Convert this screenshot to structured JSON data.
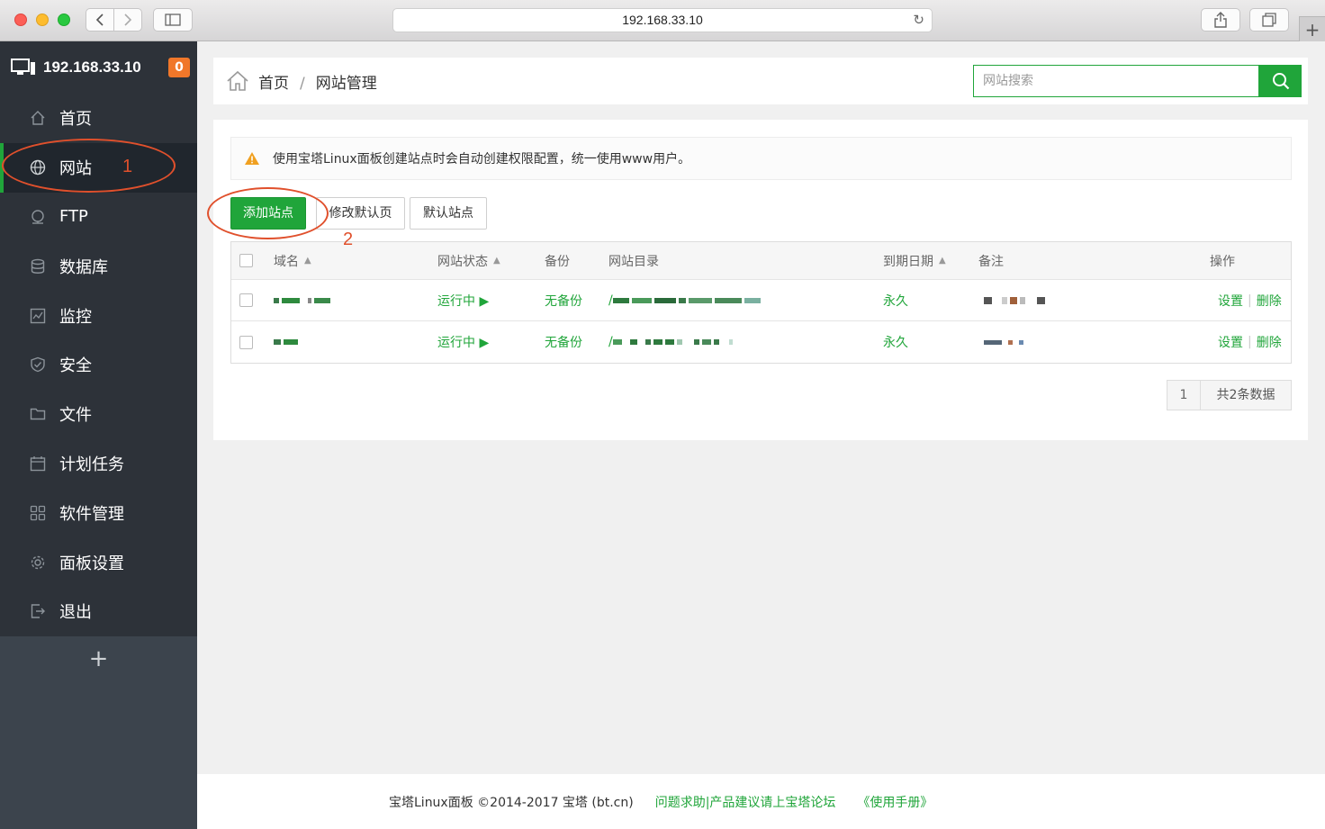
{
  "browser": {
    "address": "192.168.33.10"
  },
  "sidebar": {
    "server_ip": "192.168.33.10",
    "badge": "0",
    "items": [
      {
        "label": "首页",
        "icon": "home-icon"
      },
      {
        "label": "网站",
        "icon": "globe-icon",
        "active": true
      },
      {
        "label": "FTP",
        "icon": "ftp-icon"
      },
      {
        "label": "数据库",
        "icon": "database-icon"
      },
      {
        "label": "监控",
        "icon": "monitor-icon"
      },
      {
        "label": "安全",
        "icon": "shield-icon"
      },
      {
        "label": "文件",
        "icon": "folder-icon"
      },
      {
        "label": "计划任务",
        "icon": "calendar-icon"
      },
      {
        "label": "软件管理",
        "icon": "grid-icon"
      },
      {
        "label": "面板设置",
        "icon": "gear-icon"
      },
      {
        "label": "退出",
        "icon": "logout-icon"
      }
    ],
    "add_label": "+"
  },
  "breadcrumb": {
    "home": "首页",
    "separator": "/",
    "current": "网站管理"
  },
  "search": {
    "placeholder": "网站搜索"
  },
  "notice": {
    "text": "使用宝塔Linux面板创建站点时会自动创建权限配置，统一使用www用户。"
  },
  "buttons": {
    "add_site": "添加站点",
    "edit_default_page": "修改默认页",
    "default_site": "默认站点"
  },
  "table": {
    "columns": {
      "domain": "域名",
      "status": "网站状态",
      "backup": "备份",
      "root": "网站目录",
      "expire": "到期日期",
      "remark": "备注",
      "ops": "操作"
    },
    "rows": [
      {
        "status": "运行中 ▶",
        "backup": "无备份",
        "root_prefix": "/",
        "expire": "永久",
        "op_settings": "设置",
        "op_delete": "删除"
      },
      {
        "status": "运行中 ▶",
        "backup": "无备份",
        "root_prefix": "/",
        "expire": "永久",
        "op_settings": "设置",
        "op_delete": "删除"
      }
    ]
  },
  "pager": {
    "page": "1",
    "total": "共2条数据"
  },
  "footer": {
    "copyright": "宝塔Linux面板 ©2014-2017 宝塔 (bt.cn)",
    "forum_link": "问题求助|产品建议请上宝塔论坛",
    "manual_link": "《使用手册》"
  },
  "annotations": {
    "one": "1",
    "two": "2"
  },
  "colors": {
    "accent": "#20a53a",
    "sidebar_bg": "#3c444d",
    "annotation": "#e0502c",
    "badge": "#f0772a"
  }
}
